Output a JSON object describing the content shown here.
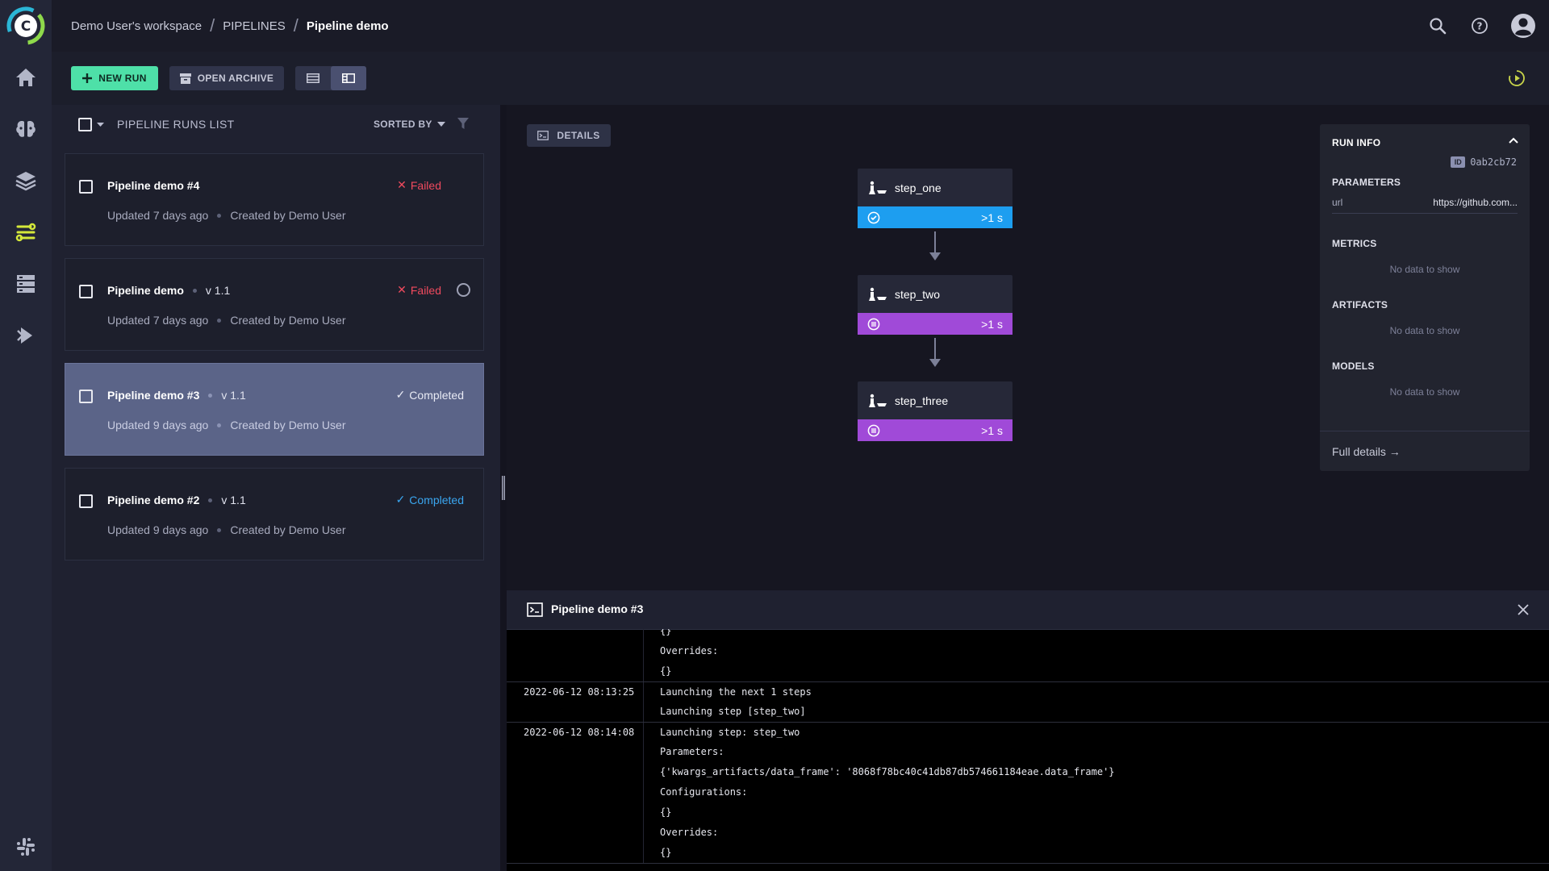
{
  "breadcrumb": {
    "workspace": "Demo User's workspace",
    "section": "PIPELINES",
    "current": "Pipeline demo"
  },
  "icons": {
    "logo": "clearml-logo-icon",
    "nav": [
      "home-icon",
      "brain-icon",
      "layers-icon",
      "pipelines-icon",
      "datasets-icon",
      "reports-icon"
    ],
    "bottom": "slack-icon",
    "top": [
      "search-icon",
      "help-icon",
      "user-avatar-icon"
    ]
  },
  "colors": {
    "accent": "#4ee0a8",
    "failed": "#f04a5e",
    "completed_blue": "#3aa6f0",
    "step_done": "#1d9ef0",
    "step_pending": "#a04ad8",
    "nav_active": "#d4e83a"
  },
  "toolbar": {
    "new_run": "NEW RUN",
    "open_archive": "OPEN ARCHIVE"
  },
  "list": {
    "title": "PIPELINE RUNS LIST",
    "sorted_by": "SORTED BY",
    "runs": [
      {
        "name": "Pipeline demo #4",
        "version": "",
        "status": "Failed",
        "updated": "Updated 7 days ago",
        "created": "Created by Demo User"
      },
      {
        "name": "Pipeline demo",
        "version": "v 1.1",
        "status": "Failed",
        "updated": "Updated 7 days ago",
        "created": "Created by Demo User"
      },
      {
        "name": "Pipeline demo #3",
        "version": "v 1.1",
        "status": "Completed",
        "updated": "Updated 9 days ago",
        "created": "Created by Demo User"
      },
      {
        "name": "Pipeline demo #2",
        "version": "v 1.1",
        "status": "Completed",
        "updated": "Updated 9 days ago",
        "created": "Created by Demo User"
      }
    ]
  },
  "canvas": {
    "details": "DETAILS",
    "steps": [
      {
        "name": "step_one",
        "duration": ">1 s",
        "state": "completed"
      },
      {
        "name": "step_two",
        "duration": ">1 s",
        "state": "pending"
      },
      {
        "name": "step_three",
        "duration": ">1 s",
        "state": "pending"
      }
    ]
  },
  "run_info": {
    "title": "RUN INFO",
    "id_badge": "ID",
    "id": "0ab2cb72",
    "parameters_label": "PARAMETERS",
    "param_key": "url",
    "param_value": "https://github.com...",
    "metrics_label": "METRICS",
    "artifacts_label": "ARTIFACTS",
    "models_label": "MODELS",
    "empty_text": "No data to show",
    "full_details": "Full details →"
  },
  "log": {
    "title": "Pipeline demo #3",
    "rows": [
      {
        "ts": "",
        "msg": "{}"
      },
      {
        "ts": "",
        "msg": "Overrides:"
      },
      {
        "ts": "",
        "msg": "{}"
      },
      {
        "ts": "2022-06-12 08:13:25",
        "msg": "Launching the next 1 steps"
      },
      {
        "ts": "",
        "msg": "Launching step [step_two]"
      },
      {
        "ts": "2022-06-12 08:14:08",
        "msg": "Launching step: step_two"
      },
      {
        "ts": "",
        "msg": "Parameters:"
      },
      {
        "ts": "",
        "msg": "{'kwargs_artifacts/data_frame': '8068f78bc40c41db87db574661184eae.data_frame'}"
      },
      {
        "ts": "",
        "msg": "Configurations:"
      },
      {
        "ts": "",
        "msg": "{}"
      },
      {
        "ts": "",
        "msg": "Overrides:"
      },
      {
        "ts": "",
        "msg": "{}"
      }
    ]
  }
}
